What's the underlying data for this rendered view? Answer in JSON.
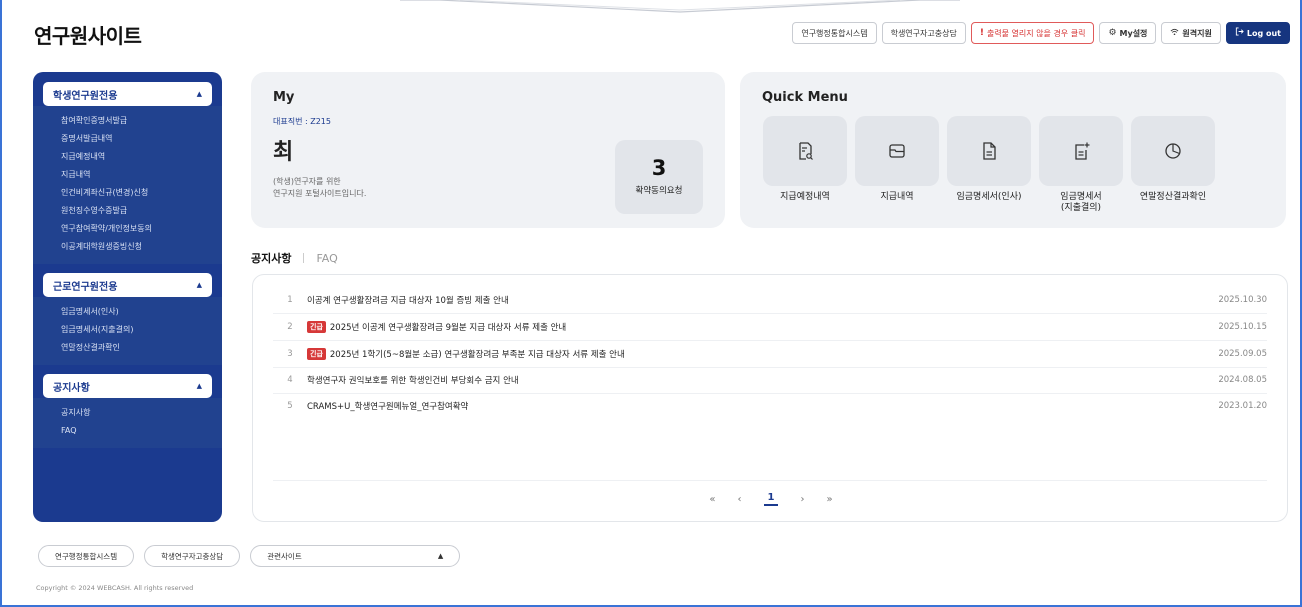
{
  "header": {
    "logo": "연구원사이트",
    "buttons": [
      {
        "label": "연구행정통합시스템"
      },
      {
        "label": "학생연구자고충상담"
      },
      {
        "label": "출력물 열리지 않을 경우 클릭"
      },
      {
        "label": "My설정",
        "icon": "gear-icon"
      },
      {
        "label": "원격지원",
        "icon": "wifi-icon"
      },
      {
        "label": "Log out",
        "icon": "logout-icon"
      }
    ],
    "alert_mark": "!"
  },
  "sidebar": {
    "sections": [
      {
        "title": "학생연구원전용",
        "items": [
          "참여확인증명서발급",
          "증명서발급내역",
          "지급예정내역",
          "지급내역",
          "인건비계좌신규(변경)신청",
          "원천징수영수증발급",
          "연구참여확약/개인정보동의",
          "이공계대학원생증빙신청"
        ]
      },
      {
        "title": "근로연구원전용",
        "items": [
          "임금명세서(인사)",
          "임금명세서(지출결의)",
          "연말정산결과확인"
        ]
      },
      {
        "title": "공지사항",
        "items": [
          "공지사항",
          "FAQ"
        ]
      }
    ]
  },
  "my": {
    "title": "My",
    "rep_number": "대표직번 : Z215",
    "name": "최",
    "desc_line1": "(학생)연구자를 위한",
    "desc_line2": "연구지원 포털사이트입니다.",
    "consent_count": "3",
    "consent_label": "확약동의요청"
  },
  "quick_menu": {
    "title": "Quick Menu",
    "items": [
      {
        "label": "지급예정내역",
        "icon": "document-search-icon"
      },
      {
        "label": "지급내역",
        "icon": "folder-icon"
      },
      {
        "label": "임금명세서(인사)",
        "icon": "document-icon"
      },
      {
        "label": "임금명세서\n(지출결의)",
        "icon": "document-add-icon"
      },
      {
        "label": "연말정산결과확인",
        "icon": "pie-chart-icon"
      }
    ]
  },
  "tabs": {
    "notice": "공지사항",
    "faq": "FAQ"
  },
  "notices": [
    {
      "index": "1",
      "badge": "",
      "title": "이공계 연구생활장려금 지급 대상자 10월 증빙 제출 안내",
      "date": "2025.10.30"
    },
    {
      "index": "2",
      "badge": "긴급",
      "title": "2025년 이공계 연구생활장려금 9월분 지급 대상자 서류 제출 안내",
      "date": "2025.10.15"
    },
    {
      "index": "3",
      "badge": "긴급",
      "title": "2025년 1학기(5~8월분 소급) 연구생활장려금 부족분 지급 대상자 서류 제출 안내",
      "date": "2025.09.05"
    },
    {
      "index": "4",
      "badge": "",
      "title": "학생연구자 권익보호를 위한 학생인건비 부당회수 금지 안내",
      "date": "2024.08.05"
    },
    {
      "index": "5",
      "badge": "",
      "title": "CRAMS+U_학생연구원메뉴얼_연구참여확약",
      "date": "2023.01.20"
    }
  ],
  "pagination": {
    "first": "«",
    "prev": "‹",
    "current": "1",
    "next": "›",
    "last": "»"
  },
  "footer": {
    "buttons": [
      "연구행정통합시스템",
      "학생연구자고충상담"
    ],
    "related_sites": "관련사이트",
    "copyright": "Copyright © 2024 WEBCASH. All rights reserved"
  }
}
